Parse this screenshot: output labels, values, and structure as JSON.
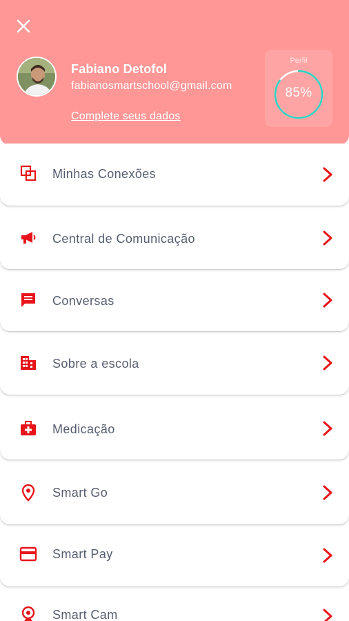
{
  "header": {
    "user_name": "Fabiano Detofol",
    "user_email": "fabianosmartschool@gmail.com",
    "complete_link": "Complete seus dados",
    "profile_label": "Perfil",
    "profile_percent_text": "85%",
    "profile_completion": 0.85,
    "background_color": "#ff9797",
    "ring_color": "#2ad4c4"
  },
  "menu": {
    "accent_color": "#e8141b",
    "items": [
      {
        "label": "Minhas Conexões",
        "icon": "connections-icon"
      },
      {
        "label": "Central de Comunicação",
        "icon": "megaphone-icon"
      },
      {
        "label": "Conversas",
        "icon": "chat-icon"
      },
      {
        "label": "Sobre a escola",
        "icon": "building-icon"
      },
      {
        "label": "Medicação",
        "icon": "medical-kit-icon"
      },
      {
        "label": "Smart Go",
        "icon": "location-pin-icon"
      },
      {
        "label": "Smart Pay",
        "icon": "credit-card-icon"
      },
      {
        "label": "Smart Cam",
        "icon": "webcam-icon"
      }
    ]
  }
}
